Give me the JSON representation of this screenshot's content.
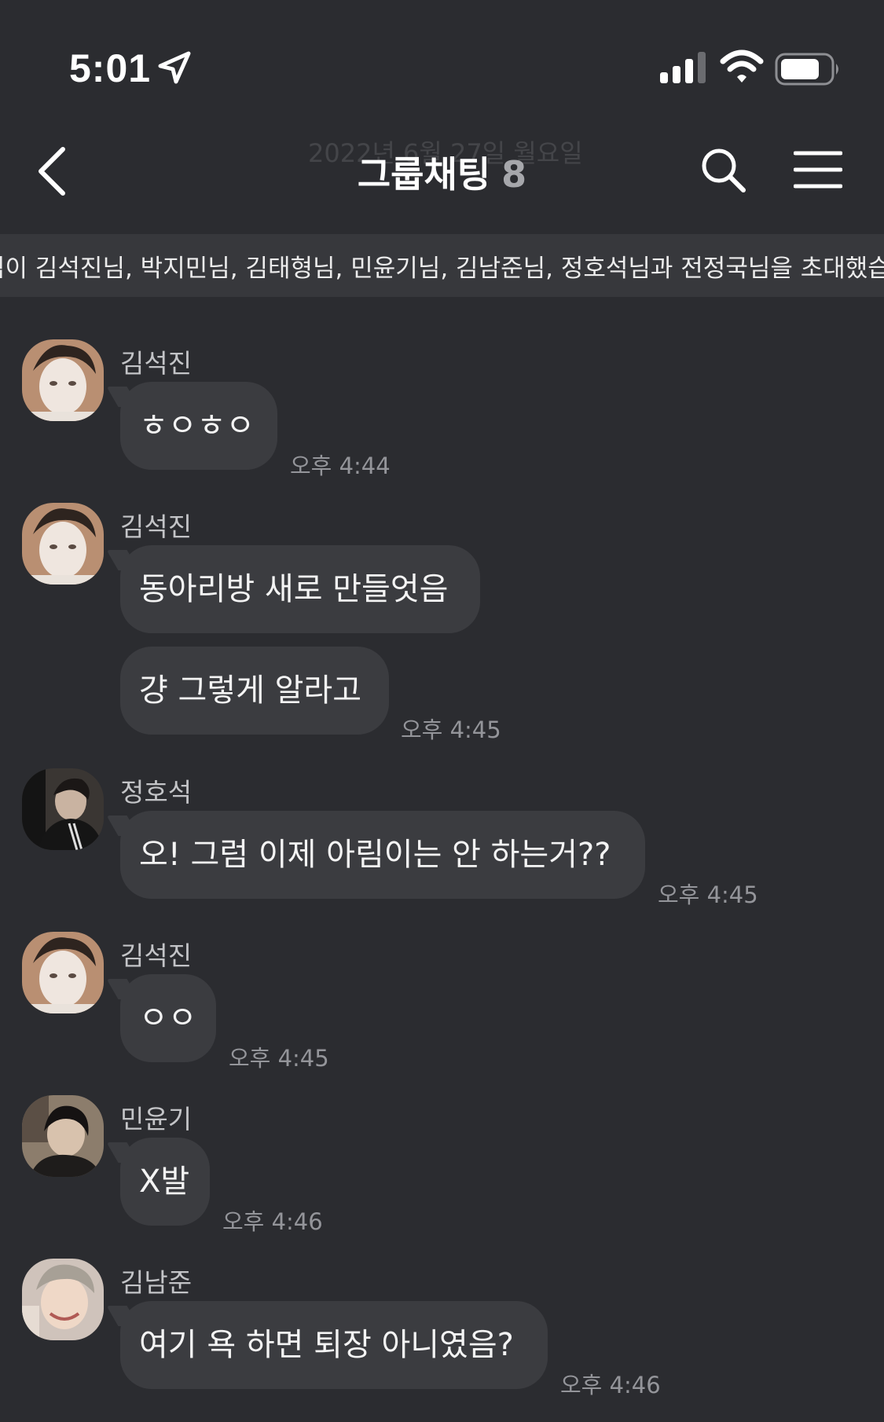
{
  "status_bar": {
    "time": "5:01"
  },
  "header": {
    "date_ghost": "2022년 6월 27일 월요일",
    "title": "그룹채팅",
    "member_count": "8"
  },
  "system_notice": {
    "text": "님이 김석진님, 박지민님, 김태형님, 민윤기님, 김남준님, 정호석님과 전정국님을 초대했습니다."
  },
  "messages": [
    {
      "sender": "김석진",
      "bubbles": [
        "ㅎㅇㅎㅇ"
      ],
      "time": "오후 4:44"
    },
    {
      "sender": "김석진",
      "bubbles": [
        "동아리방 새로 만들엇음",
        "걍 그렇게 알라고"
      ],
      "time": "오후 4:45"
    },
    {
      "sender": "정호석",
      "bubbles": [
        "오! 그럼 이제 아림이는 안 하는거??"
      ],
      "time": "오후 4:45"
    },
    {
      "sender": "김석진",
      "bubbles": [
        "ㅇㅇ"
      ],
      "time": "오후 4:45"
    },
    {
      "sender": "민윤기",
      "bubbles": [
        "X발"
      ],
      "time": "오후 4:46"
    },
    {
      "sender": "김남준",
      "bubbles": [
        "여기 욕 하면 퇴장 아니였음?"
      ],
      "time": "오후 4:46"
    }
  ],
  "colors": {
    "background": "#2b2c30",
    "bubble": "#3b3c40",
    "notice_bar": "#37383c",
    "timestamp": "#94959a"
  }
}
